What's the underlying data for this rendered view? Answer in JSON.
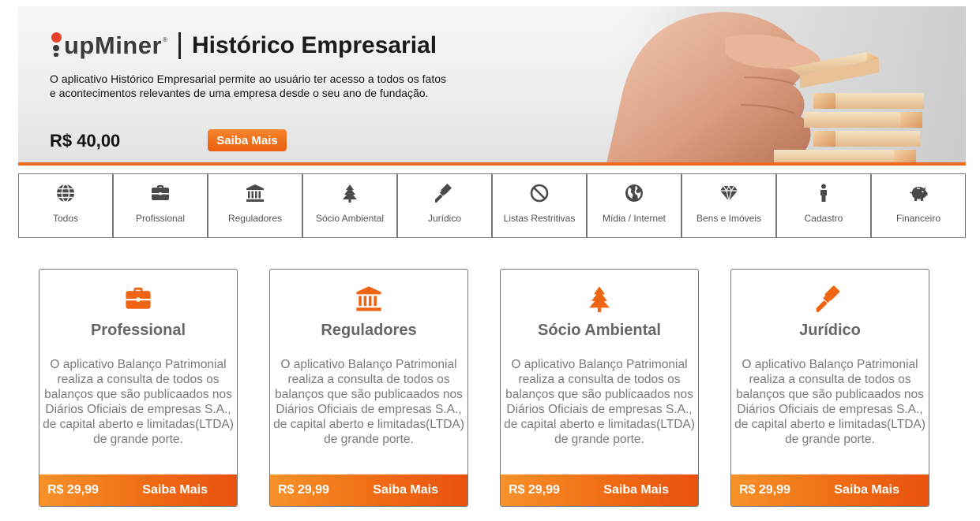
{
  "banner": {
    "logo_text": "upMiner",
    "logo_reg": "®",
    "title": "Histórico Empresarial",
    "description": "O aplicativo Histórico Empresarial permite ao usuário ter acesso a todos os fatos e acontecimentos relevantes de uma empresa desde o seu ano de fundação.",
    "price": "R$ 40,00",
    "cta_label": "Saiba Mais",
    "image": "hand-stacking-wooden-blocks",
    "accent_color": "#f26a1b"
  },
  "tabs": [
    {
      "label": "Todos",
      "icon": "globe-icon"
    },
    {
      "label": "Profissional",
      "icon": "briefcase-icon"
    },
    {
      "label": "Reguladores",
      "icon": "institution-icon"
    },
    {
      "label": "Sócio Ambiental",
      "icon": "tree-icon"
    },
    {
      "label": "Jurídico",
      "icon": "gavel-icon"
    },
    {
      "label": "Listas Restritivas",
      "icon": "ban-icon"
    },
    {
      "label": "Mídia / Internet",
      "icon": "earth-icon"
    },
    {
      "label": "Bens e Imóveis",
      "icon": "diamond-icon"
    },
    {
      "label": "Cadastro",
      "icon": "person-icon"
    },
    {
      "label": "Financeiro",
      "icon": "piggy-bank-icon"
    }
  ],
  "cards": [
    {
      "title": "Professional",
      "icon": "briefcase-icon",
      "description": "O aplicativo Balanço Patrimonial realiza a consulta de todos os balanços que são publicaados nos Diários Oficiais de empresas S.A., de capital aberto e limitadas(LTDA) de grande porte.",
      "price": "R$ 29,99",
      "cta_label": "Saiba Mais"
    },
    {
      "title": "Reguladores",
      "icon": "institution-icon",
      "description": "O aplicativo Balanço Patrimonial realiza a consulta de todos os balanços que são publicaados nos Diários Oficiais de empresas S.A., de capital aberto e limitadas(LTDA) de grande porte.",
      "price": "R$ 29,99",
      "cta_label": "Saiba Mais"
    },
    {
      "title": "Sócio Ambiental",
      "icon": "tree-icon",
      "description": "O aplicativo Balanço Patrimonial realiza a consulta de todos os balanços que são publicaados nos Diários Oficiais de empresas S.A., de capital aberto e limitadas(LTDA) de grande porte.",
      "price": "R$ 29,99",
      "cta_label": "Saiba Mais"
    },
    {
      "title": "Jurídico",
      "icon": "gavel-icon",
      "description": "O aplicativo Balanço Patrimonial realiza a consulta de todos os balanços que são publicaados nos Diários Oficiais de empresas S.A., de capital aberto e limitadas(LTDA) de grande porte.",
      "price": "R$ 29,99",
      "cta_label": "Saiba Mais"
    }
  ]
}
